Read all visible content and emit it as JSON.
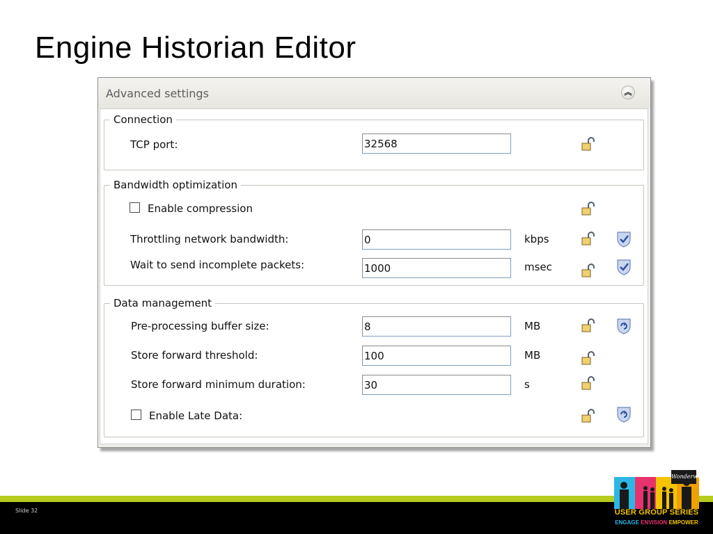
{
  "slide": {
    "title": "Engine Historian Editor",
    "slide_number": "Slide 32"
  },
  "panel": {
    "header_label": "Advanced settings",
    "collapse_icon": "chevron-double-up-icon"
  },
  "groups": {
    "connection": {
      "legend": "Connection",
      "tcp_port_label": "TCP port:",
      "tcp_port_value": "32568"
    },
    "bandwidth": {
      "legend": "Bandwidth optimization",
      "enable_compression_label": "Enable compression",
      "enable_compression_checked": false,
      "throttling_label": "Throttling network bandwidth:",
      "throttling_value": "0",
      "throttling_unit": "kbps",
      "wait_label": "Wait to send incomplete packets:",
      "wait_value": "1000",
      "wait_unit": "msec"
    },
    "data_management": {
      "legend": "Data management",
      "preproc_label": "Pre-processing buffer size:",
      "preproc_value": "8",
      "preproc_unit": "MB",
      "sf_threshold_label": "Store forward threshold:",
      "sf_threshold_value": "100",
      "sf_threshold_unit": "MB",
      "sf_min_duration_label": "Store forward minimum duration:",
      "sf_min_duration_value": "30",
      "sf_min_duration_unit": "s",
      "enable_late_data_label": "Enable Late Data:",
      "enable_late_data_checked": false
    }
  },
  "logo": {
    "line1": "USER GROUP SERIES",
    "engage": "ENGAGE",
    "envision": "ENVISION",
    "empower": "EMPOWER",
    "script": "Wonderware"
  },
  "colors": {
    "accent_green": "#b6cd20",
    "footer_black": "#000000",
    "logo_yellow": "#f5c400",
    "logo_cyan": "#2ab7e6",
    "logo_magenta": "#e8326d"
  }
}
